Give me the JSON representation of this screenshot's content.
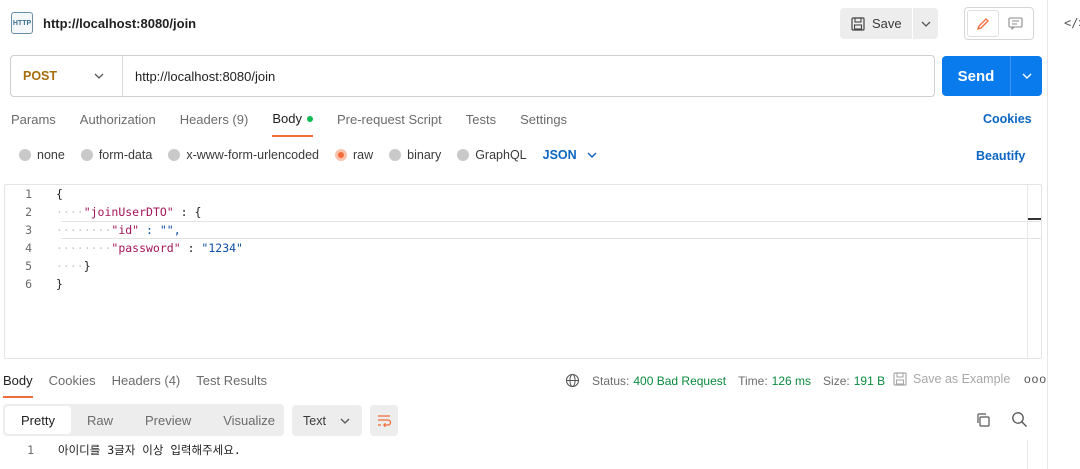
{
  "header": {
    "icon_label": "HTTP",
    "title": "http://localhost:8080/join",
    "save_label": "Save",
    "side_icon": "</>"
  },
  "request": {
    "method": "POST",
    "url": "http://localhost:8080/join",
    "send_label": "Send"
  },
  "request_tabs": [
    {
      "label": "Params"
    },
    {
      "label": "Authorization"
    },
    {
      "label": "Headers (9)"
    },
    {
      "label": "Body"
    },
    {
      "label": "Pre-request Script"
    },
    {
      "label": "Tests"
    },
    {
      "label": "Settings"
    }
  ],
  "cookies_label": "Cookies",
  "body_options": {
    "none": "none",
    "form_data": "form-data",
    "urlencoded": "x-www-form-urlencoded",
    "raw": "raw",
    "binary": "binary",
    "graphql": "GraphQL",
    "format": "JSON",
    "beautify": "Beautify"
  },
  "editor": {
    "line_numbers": [
      "1",
      "2",
      "3",
      "4",
      "5",
      "6"
    ],
    "l1": "{",
    "l2_key": "\"joinUserDTO\"",
    "l2_rest": " : {",
    "l3_key": "\"id\"",
    "l3_rest": " : \"\",",
    "l4_key": "\"password\"",
    "l4_sep": " : ",
    "l4_val": "\"1234\"",
    "l5": "}",
    "l6": "}"
  },
  "response": {
    "tabs": [
      {
        "label": "Body"
      },
      {
        "label": "Cookies"
      },
      {
        "label": "Headers (4)"
      },
      {
        "label": "Test Results"
      }
    ],
    "status_label": "Status:",
    "status_value": "400 Bad Request",
    "time_label": "Time:",
    "time_value": "126 ms",
    "size_label": "Size:",
    "size_value": "191 B",
    "save_example": "Save as Example",
    "more": "ooo",
    "format_tabs": [
      {
        "label": "Pretty"
      },
      {
        "label": "Raw"
      },
      {
        "label": "Preview"
      },
      {
        "label": "Visualize"
      }
    ],
    "text_select": "Text",
    "line_number": "1",
    "body_text": "아이디를 3글자 이상 입력해주세요."
  },
  "colors": {
    "accent_orange": "#f26b3a",
    "send_blue": "#097bed",
    "link_blue": "#0d66c2",
    "method_color": "#a66e0c",
    "status_green": "#0a8a3e"
  }
}
